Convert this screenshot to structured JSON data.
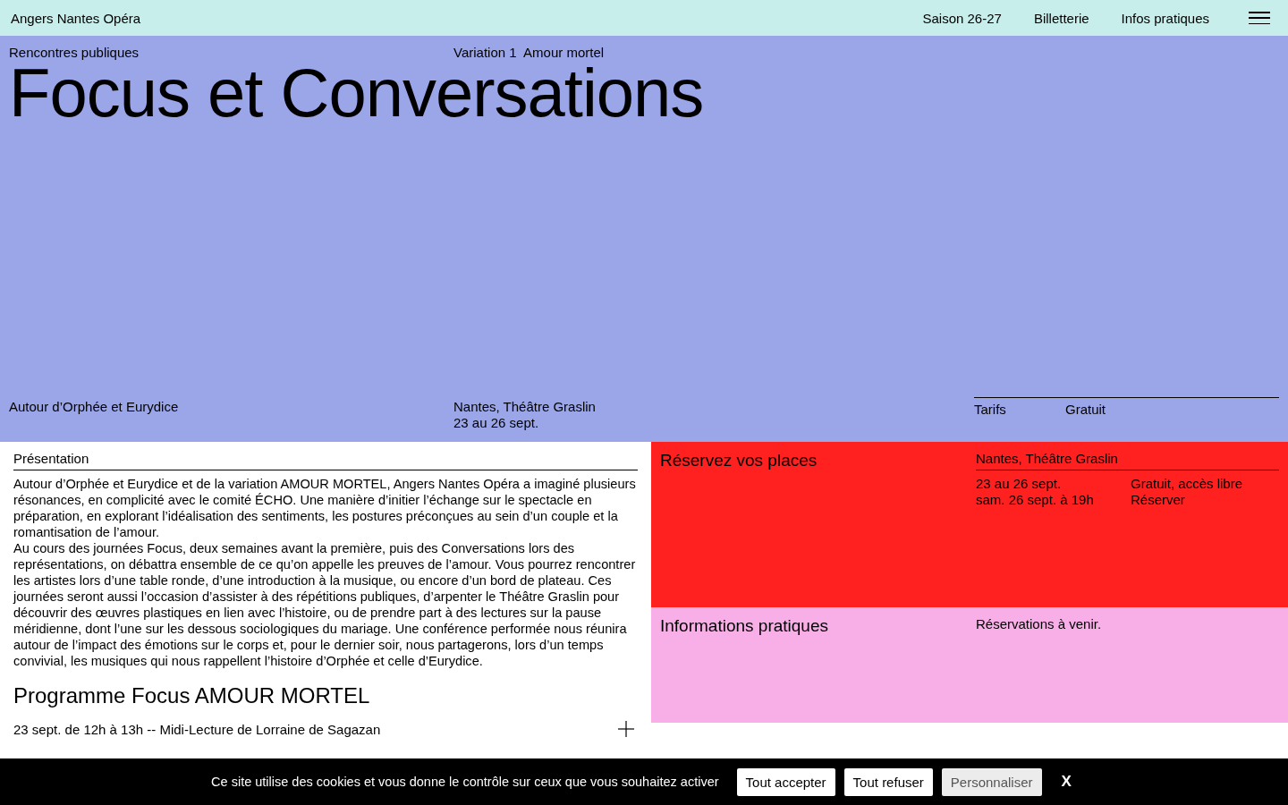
{
  "header": {
    "logo": "Angers Nantes Opéra",
    "nav": [
      "Saison 26-27",
      "Billetterie",
      "Infos pratiques"
    ]
  },
  "hero": {
    "category": "Rencontres publiques",
    "variation": "Variation 1  Amour mortel",
    "title": "Focus et Conversations",
    "subtitle": "Autour d’Orphée et Eurydice",
    "venue": "Nantes, Théâtre Graslin",
    "dates": "23 au 26 sept.",
    "tariff_label": "Tarifs",
    "tariff_value": "Gratuit"
  },
  "presentation": {
    "heading": "Présentation",
    "paragraphs": [
      "Autour d’Orphée et Eurydice et de la variation AMOUR MORTEL, Angers Nantes Opéra a imaginé plusieurs résonances, en complicité avec le comité ÉCHO. Une manière d’initier l’échange sur le spectacle en préparation, en explorant l’idéalisation des sentiments, les postures préconçues au sein d’un couple et la romantisation de l’amour.",
      "Au cours des journées Focus, deux semaines avant la première, puis des Conversations lors des représentations, on débattra ensemble de ce qu’on appelle les preuves de l’amour. Vous pourrez rencontrer les artistes lors d’une table ronde, d’une introduction à la musique, ou encore d’un bord de plateau. Ces journées seront aussi l’occasion d’assister à des répétitions publiques, d’arpenter le Théâtre Graslin pour découvrir des œuvres plastiques en lien avec l’histoire, ou de prendre part à des lectures sur la pause méridienne, dont l’une sur les dessous sociologiques du mariage. Une conférence performée nous réunira autour de l’impact des émotions sur le corps et, pour le dernier soir, nous partagerons, lors d’un temps convivial, les musiques qui nous rappellent l’histoire d’Orphée et celle d’Eurydice."
    ]
  },
  "programme": {
    "heading": "Programme Focus AMOUR MORTEL",
    "items": [
      {
        "label": "23 sept. de 12h à 13h -- Midi-Lecture de Lorraine de Sagazan",
        "expanded": false
      }
    ]
  },
  "booking": {
    "heading": "Réservez vos places",
    "venue": "Nantes, Théâtre Graslin",
    "dates": [
      "23 au 26 sept.",
      "sam. 26 sept. à 19h"
    ],
    "price": "Gratuit, accès libre",
    "link": "Réserver"
  },
  "info": {
    "heading": "Informations pratiques",
    "note": "Réservations à venir."
  },
  "cookies": {
    "message": "Ce site utilise des cookies et vous donne le contrôle sur ceux que vous souhaitez activer",
    "buttons": [
      {
        "label": "Tout accepter",
        "kind": "primary"
      },
      {
        "label": "Tout refuser",
        "kind": "primary"
      },
      {
        "label": "Personnaliser",
        "kind": "secondary"
      }
    ],
    "close": "X"
  }
}
